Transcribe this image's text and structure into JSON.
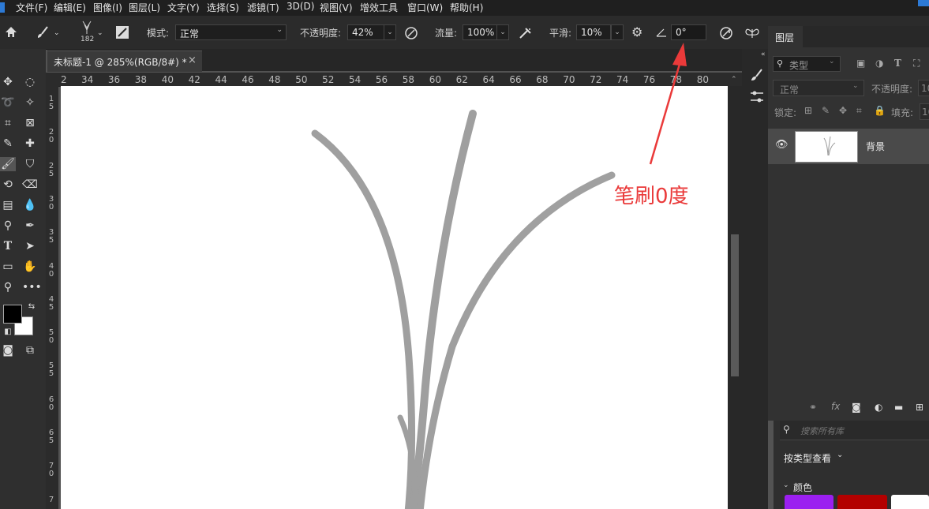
{
  "menu": {
    "items": [
      "文件(F)",
      "编辑(E)",
      "图像(I)",
      "图层(L)",
      "文字(Y)",
      "选择(S)",
      "滤镜(T)",
      "3D(D)",
      "视图(V)",
      "增效工具",
      "窗口(W)",
      "帮助(H)"
    ]
  },
  "options": {
    "brush_size": "182",
    "mode_label": "模式:",
    "mode_value": "正常",
    "opacity_label": "不透明度:",
    "opacity_value": "42%",
    "flow_label": "流量:",
    "flow_value": "100%",
    "smooth_label": "平滑:",
    "smooth_value": "10%",
    "angle_value": "0°"
  },
  "document": {
    "tab_title": "未标题-1 @ 285%(RGB/8#) *",
    "close_glyph": "×"
  },
  "rulers": {
    "horizontal": [
      "2",
      "34",
      "36",
      "38",
      "40",
      "42",
      "44",
      "46",
      "48",
      "50",
      "52",
      "54",
      "56",
      "58",
      "60",
      "62",
      "64",
      "66",
      "68",
      "70",
      "72",
      "74",
      "76",
      "78",
      "80"
    ],
    "vertical": [
      [
        "1",
        "5"
      ],
      [
        "2",
        "0"
      ],
      [
        "2",
        "5"
      ],
      [
        "3",
        "0"
      ],
      [
        "3",
        "5"
      ],
      [
        "4",
        "0"
      ],
      [
        "4",
        "5"
      ],
      [
        "5",
        "0"
      ],
      [
        "5",
        "5"
      ],
      [
        "6",
        "0"
      ],
      [
        "6",
        "5"
      ],
      [
        "7",
        "0"
      ],
      [
        "7"
      ]
    ]
  },
  "annotation": {
    "text": "笔刷0度",
    "color": "#ea3a3a"
  },
  "layers_panel": {
    "title": "图层",
    "filter_kind": "类型",
    "blend_mode": "正常",
    "opacity_label": "不透明度:",
    "opacity_value": "10",
    "lock_label": "锁定:",
    "fill_label": "填充:",
    "fill_value": "10",
    "layer_name": "背景",
    "fx_label": "fx"
  },
  "libraries": {
    "search_placeholder": "搜索所有库",
    "view_label": "按类型查看",
    "colors_label": "颜色",
    "swatches": [
      "#9b1ff0",
      "#b30000",
      "#ffffff"
    ]
  },
  "colors": {
    "foreground": "#000000",
    "background": "#ffffff"
  }
}
